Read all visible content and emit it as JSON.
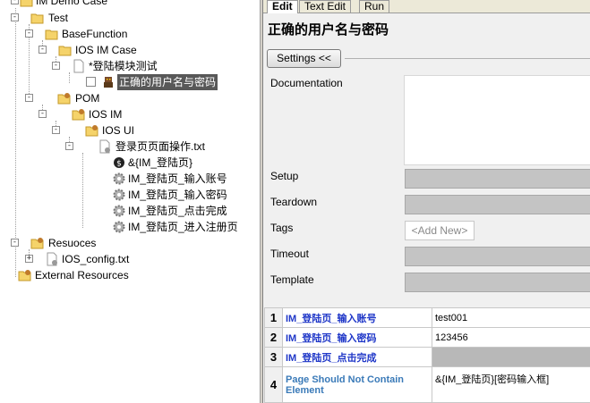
{
  "tree": {
    "items": [
      {
        "label": "IM Demo Case",
        "icon": "folder-open-icon"
      },
      {
        "label": "Test",
        "icon": "folder-open-icon"
      },
      {
        "label": "BaseFunction",
        "icon": "folder-open-icon"
      },
      {
        "label": "IOS IM Case",
        "icon": "folder-open-icon"
      },
      {
        "label": "*登陆模块测试",
        "icon": "file-icon"
      },
      {
        "label": "正确的用户名与密码",
        "icon": "robot-icon"
      },
      {
        "label": "POM",
        "icon": "folder-gear-icon"
      },
      {
        "label": "IOS IM",
        "icon": "folder-gear-icon"
      },
      {
        "label": "IOS UI",
        "icon": "folder-gear-icon"
      },
      {
        "label": "登录页页面操作.txt",
        "icon": "resource-file-icon"
      },
      {
        "label": "&{IM_登陆页}",
        "icon": "variable-icon"
      },
      {
        "label": "IM_登陆页_输入账号",
        "icon": "gear-icon"
      },
      {
        "label": "IM_登陆页_输入密码",
        "icon": "gear-icon"
      },
      {
        "label": "IM_登陆页_点击完成",
        "icon": "gear-icon"
      },
      {
        "label": "IM_登陆页_进入注册页",
        "icon": "gear-icon"
      },
      {
        "label": "Resuoces",
        "icon": "folder-gear-icon"
      },
      {
        "label": "IOS_config.txt",
        "icon": "resource-file-icon"
      },
      {
        "label": "External Resources",
        "icon": "folder-gear-icon"
      }
    ]
  },
  "editor": {
    "tabs": [
      "Edit",
      "Text Edit",
      "Run"
    ],
    "active_tab": "Edit",
    "title": "正确的用户名与密码",
    "settings_button": "Settings <<",
    "fields": {
      "documentation": "Documentation",
      "setup": "Setup",
      "teardown": "Teardown",
      "tags": "Tags",
      "timeout": "Timeout",
      "template": "Template"
    },
    "tags_placeholder": "<Add New>",
    "steps": [
      {
        "num": "1",
        "keyword": "IM_登陆页_输入账号",
        "arg": "test001"
      },
      {
        "num": "2",
        "keyword": "IM_登陆页_输入密码",
        "arg": "123456"
      },
      {
        "num": "3",
        "keyword": "IM_登陆页_点击完成",
        "arg": ""
      },
      {
        "num": "4",
        "keyword": "Page Should Not Contain Element",
        "arg": "&{IM_登陆页}[密码输入框]"
      }
    ]
  },
  "colors": {
    "selection": "#585858",
    "user_keyword": "#1f37c8",
    "library_keyword": "#3a7ab8",
    "disabled_field": "#c4c4c4"
  }
}
